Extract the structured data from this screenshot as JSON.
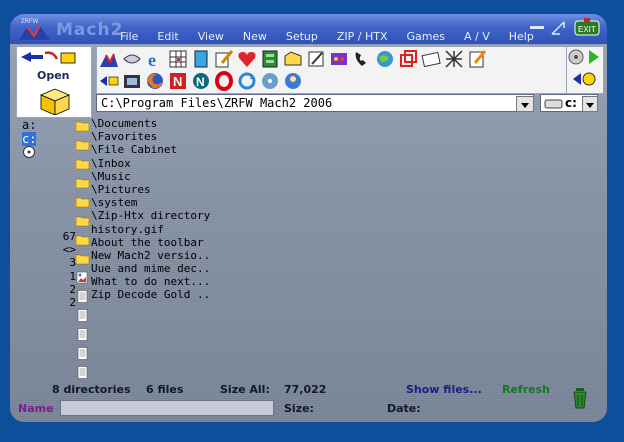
{
  "window": {
    "title": "Mach2"
  },
  "menu": [
    "File",
    "Edit",
    "View",
    "New",
    "Setup",
    "ZIP / HTX",
    "Games",
    "A / V",
    "Help"
  ],
  "left_panel": {
    "open_label": "Open"
  },
  "path": {
    "value": "C:\\Program Files\\ZRFW Mach2 2006"
  },
  "drive_select": {
    "value": "c:"
  },
  "drives": [
    "a:",
    "c:",
    ""
  ],
  "files": [
    {
      "count": "",
      "name": "\\Documents",
      "icon": "folder-icon"
    },
    {
      "count": "",
      "name": "\\Favorites",
      "icon": "folder-icon"
    },
    {
      "count": "",
      "name": "\\File Cabinet",
      "icon": "folder-icon"
    },
    {
      "count": "",
      "name": "\\Inbox",
      "icon": "folder-icon"
    },
    {
      "count": "",
      "name": "\\Music",
      "icon": "folder-icon"
    },
    {
      "count": "",
      "name": "\\Pictures",
      "icon": "folder-icon"
    },
    {
      "count": "",
      "name": "\\system",
      "icon": "folder-icon"
    },
    {
      "count": "",
      "name": "\\Zip-Htx directory",
      "icon": "folder-icon"
    },
    {
      "count": "67",
      "name": "history.gif",
      "icon": "image-file-icon"
    },
    {
      "count": "<>",
      "name": "About the toolbar",
      "icon": "text-file-icon"
    },
    {
      "count": "3",
      "name": "New Mach2 versio..",
      "icon": "text-file-icon"
    },
    {
      "count": "1",
      "name": "Uue and mime dec..",
      "icon": "text-file-icon"
    },
    {
      "count": "2",
      "name": "What to do next...",
      "icon": "text-file-icon"
    },
    {
      "count": "2",
      "name": "Zip Decode Gold ..",
      "icon": "text-file-icon"
    }
  ],
  "status": {
    "dirs": "8 directories",
    "files": "6 files",
    "size_all_label": "Size All:",
    "size_all_value": "77,022",
    "show_files": "Show files...",
    "refresh": "Refresh"
  },
  "bottom": {
    "name_label": "Name",
    "name_value": "",
    "size_label": "Size:",
    "date_label": "Date:"
  },
  "colors": {
    "desktop": "#0e4f9c",
    "titlebar": "#3f63c8",
    "show_files": "#13218a",
    "refresh": "#0f7a1e",
    "name_label": "#7d1d8a"
  }
}
